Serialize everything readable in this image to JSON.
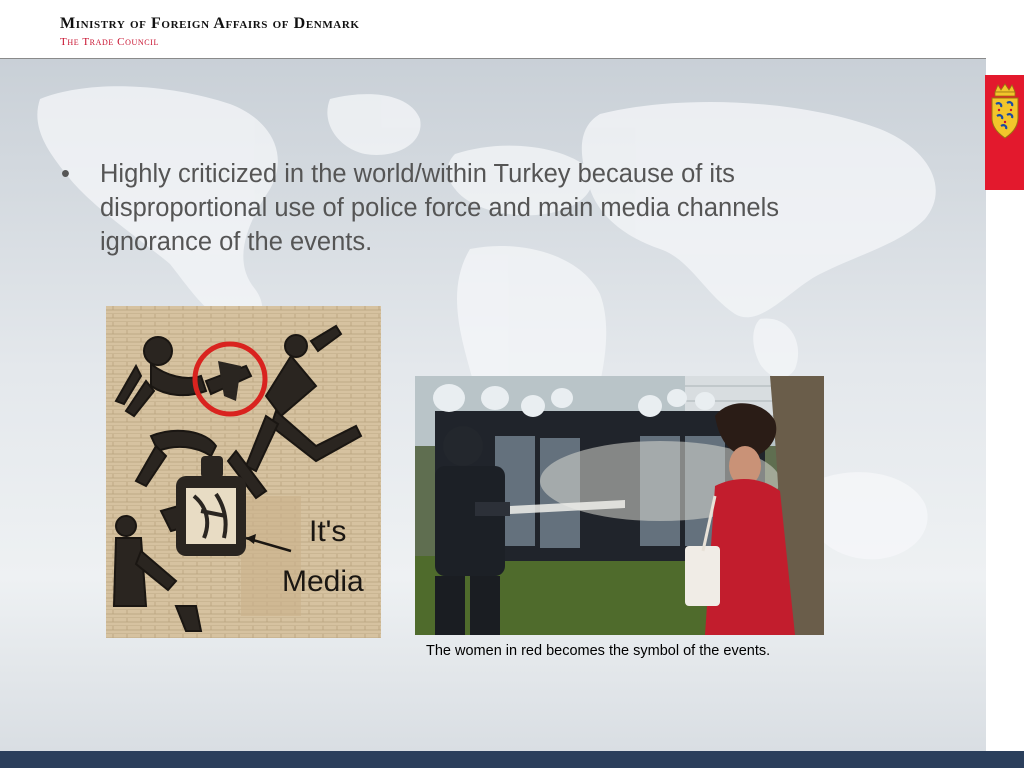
{
  "header": {
    "ministry": "Ministry of Foreign Affairs of Denmark",
    "council": "The Trade Council"
  },
  "slide": {
    "bullet_marker": "•",
    "bullet_text": "Highly criticized in the world/within Turkey because of its disproportional use of police force and main media channels ignorance of the events.",
    "cartoon_text_1": "It's",
    "cartoon_text_2": "Media",
    "caption": "The women in red becomes the symbol of the events."
  },
  "colors": {
    "accent_red": "#e3192d",
    "footer_navy": "#2b3f5c",
    "body_text": "#555555"
  },
  "icons": [
    "danish-coat-of-arms-icon",
    "world-map-background"
  ]
}
